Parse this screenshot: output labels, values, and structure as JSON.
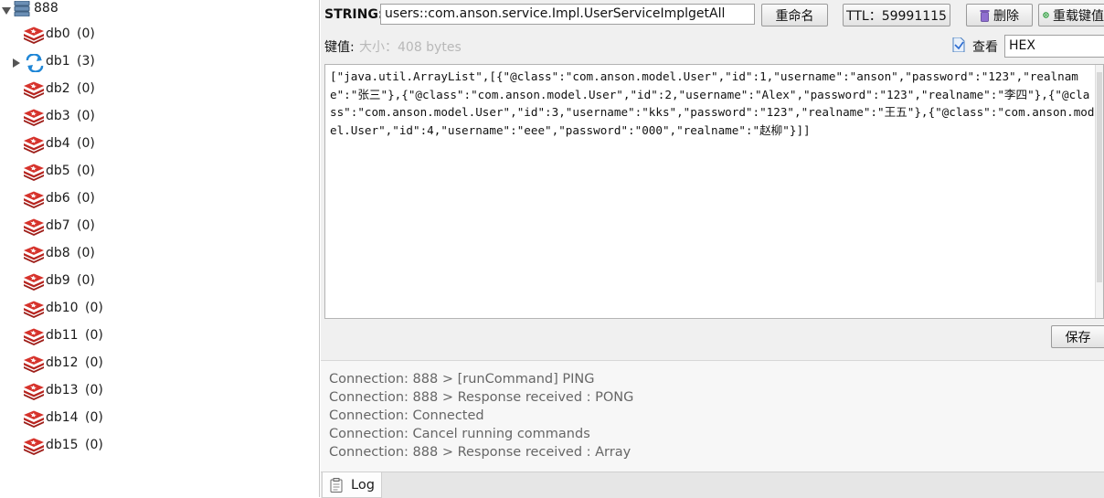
{
  "tree": {
    "server": {
      "name": "888"
    },
    "databases": [
      {
        "name": "db0",
        "count": "(0)"
      },
      {
        "name": "db1",
        "count": "(3)"
      },
      {
        "name": "db2",
        "count": "(0)"
      },
      {
        "name": "db3",
        "count": "(0)"
      },
      {
        "name": "db4",
        "count": "(0)"
      },
      {
        "name": "db5",
        "count": "(0)"
      },
      {
        "name": "db6",
        "count": "(0)"
      },
      {
        "name": "db7",
        "count": "(0)"
      },
      {
        "name": "db8",
        "count": "(0)"
      },
      {
        "name": "db9",
        "count": "(0)"
      },
      {
        "name": "db10",
        "count": "(0)"
      },
      {
        "name": "db11",
        "count": "(0)"
      },
      {
        "name": "db12",
        "count": "(0)"
      },
      {
        "name": "db13",
        "count": "(0)"
      },
      {
        "name": "db14",
        "count": "(0)"
      },
      {
        "name": "db15",
        "count": "(0)"
      }
    ]
  },
  "key": {
    "type_label": "STRING:",
    "name": "users::com.anson.service.Impl.UserServiceImplgetAll",
    "rename_label": "重命名",
    "ttl_label": "TTL：59991115",
    "delete_label": "删除",
    "reload_label": "重载键值"
  },
  "value": {
    "label": "键值:",
    "size": "大小：408 bytes",
    "view_label": "查看",
    "format": "HEX",
    "text": "[\"java.util.ArrayList\",[{\"@class\":\"com.anson.model.User\",\"id\":1,\"username\":\"anson\",\"password\":\"123\",\"realname\":\"张三\"},{\"@class\":\"com.anson.model.User\",\"id\":2,\"username\":\"Alex\",\"password\":\"123\",\"realname\":\"李四\"},{\"@class\":\"com.anson.model.User\",\"id\":3,\"username\":\"kks\",\"password\":\"123\",\"realname\":\"王五\"},{\"@class\":\"com.anson.model.User\",\"id\":4,\"username\":\"eee\",\"password\":\"000\",\"realname\":\"赵柳\"}]]",
    "save_label": "保存"
  },
  "log": {
    "lines": [
      "Connection: 888 > [runCommand] PING",
      "Connection: 888 > Response received : PONG",
      "Connection: Connected",
      "Connection: Cancel running commands",
      "Connection: 888 > Response received : Array"
    ],
    "tab_label": "Log"
  },
  "colors": {
    "db_icon": "#d6322b",
    "reload_icon": "#2a9a3a",
    "delete_icon": "#7a5ab8",
    "sync_icon": "#1f86d6"
  },
  "icons": {
    "server": "server-icon",
    "db": "redis-db-icon",
    "db1": "sync-icon",
    "delete": "trash-icon",
    "reload": "reload-icon",
    "view": "view-icon",
    "log": "clipboard-icon"
  }
}
